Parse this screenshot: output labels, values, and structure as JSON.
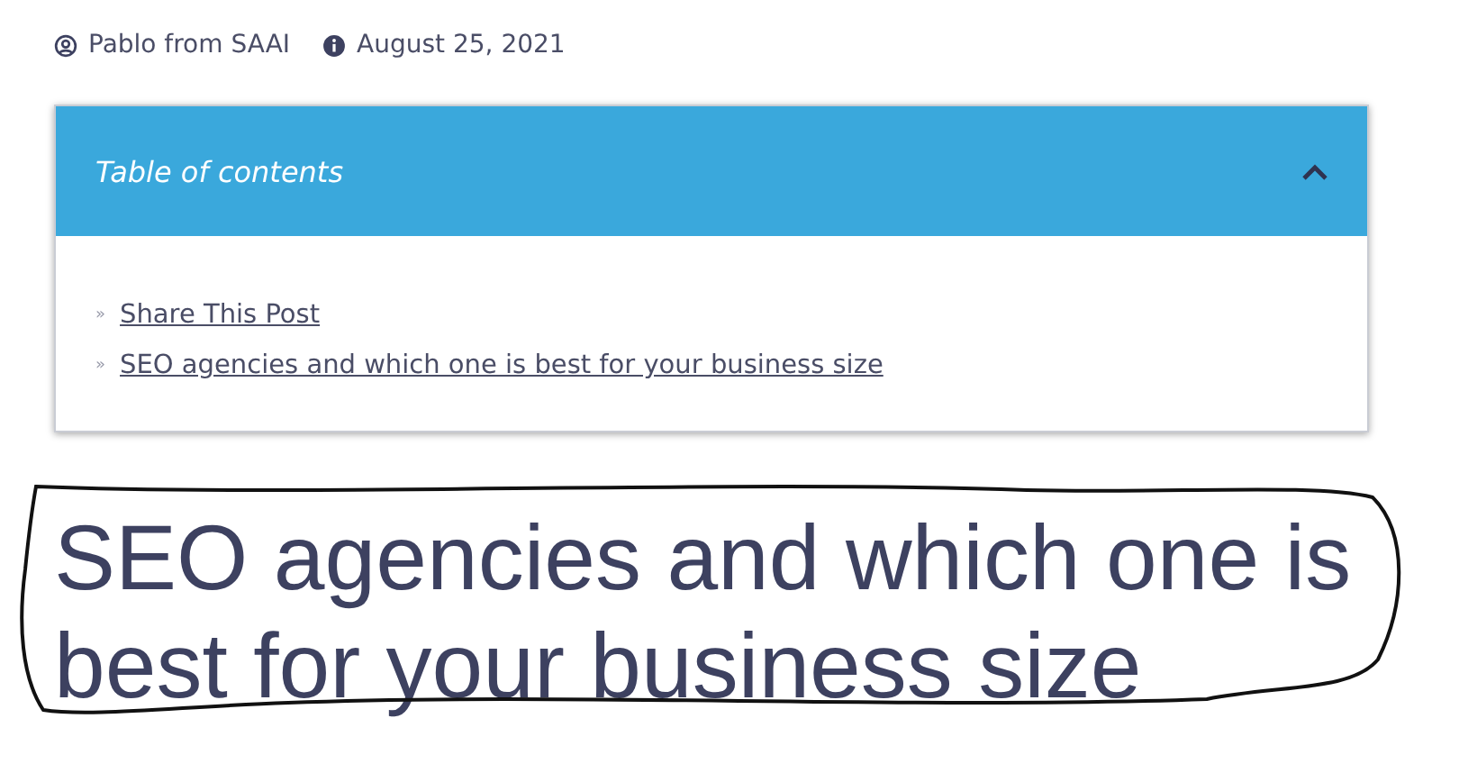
{
  "meta": {
    "author": "Pablo from SAAI",
    "date": "August 25, 2021"
  },
  "toc": {
    "title": "Table of contents",
    "expanded": true,
    "items": [
      {
        "bullet": "»",
        "label": "Share This Post"
      },
      {
        "bullet": "»",
        "label": "SEO agencies and which one is best for your business size"
      }
    ]
  },
  "heading": {
    "text": "SEO agencies and which one is best for your business size",
    "circled": true
  }
}
